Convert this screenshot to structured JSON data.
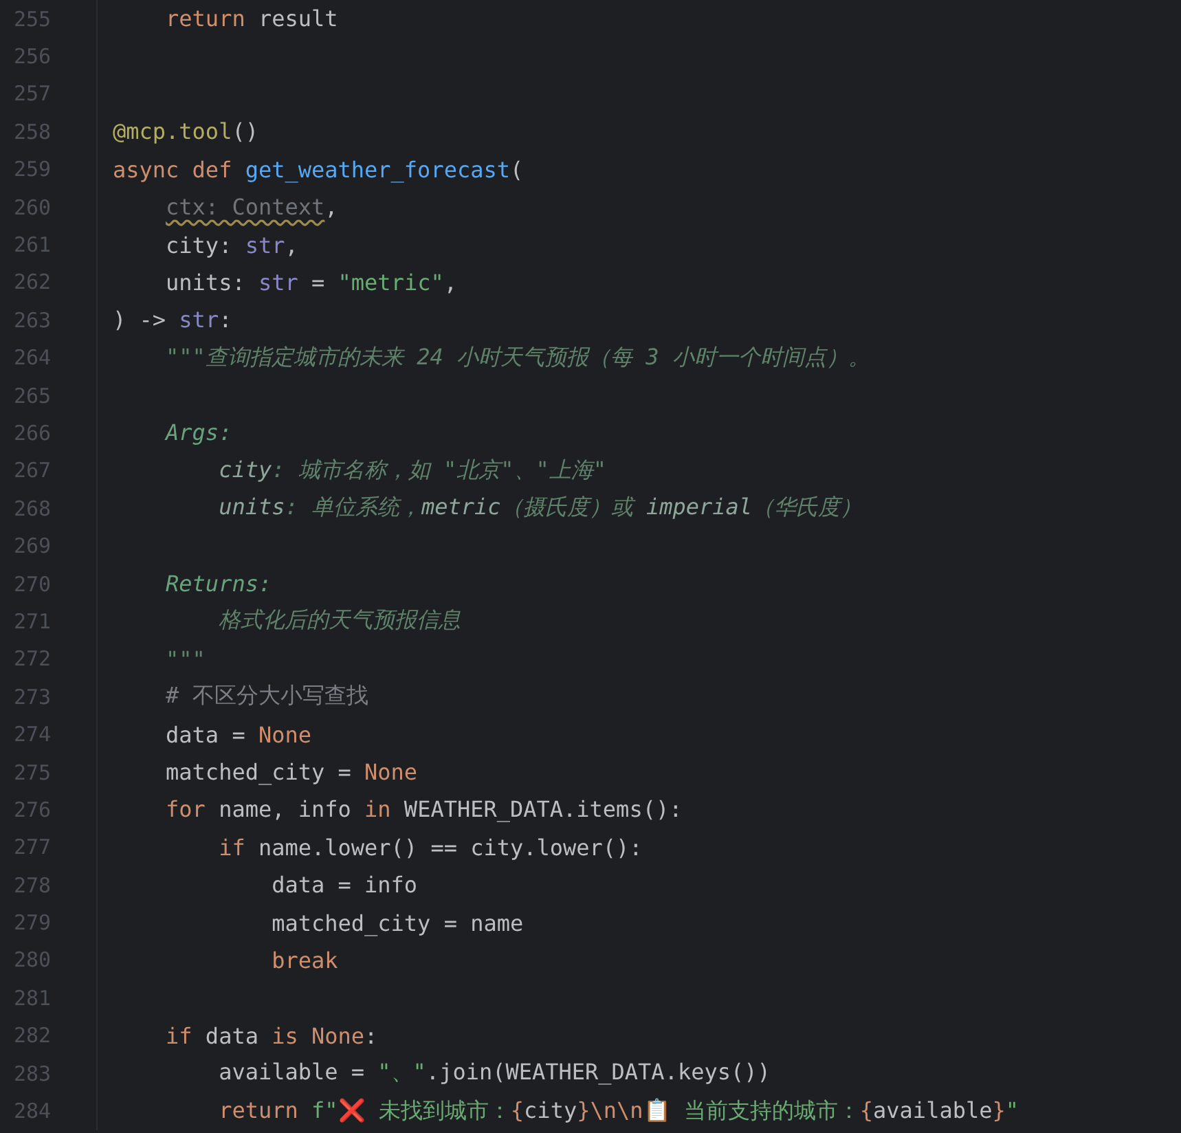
{
  "editor": {
    "lines": [
      {
        "children": [
          {
            "number": "255",
            "tokens": [
              {
                "kind": "keyword",
                "text": "return"
              },
              {
                "kind": "plain",
                "text": " result"
              }
            ]
          }
        ]
      },
      {
        "number": "256"
      },
      {
        "number": "257"
      },
      {
        "number": "258",
        "tokens": [
          {
            "kind": "decorator",
            "text": "@mcp.tool"
          },
          {
            "kind": "plain",
            "text": "()"
          }
        ]
      },
      {
        "number": "259",
        "tokens": [
          {
            "kind": "keyword",
            "text": "async def "
          },
          {
            "kind": "function",
            "text": "get_weather_forecast"
          },
          {
            "kind": "plain",
            "text": "("
          }
        ],
        "children": [
          {
            "number": "260",
            "tokens": [
              {
                "kind": "unused",
                "text": "ctx: Context"
              },
              {
                "kind": "plain",
                "text": ","
              }
            ]
          },
          {
            "number": "261",
            "tokens": [
              {
                "kind": "plain",
                "text": "city: "
              },
              {
                "kind": "type",
                "text": "str"
              },
              {
                "kind": "plain",
                "text": ","
              }
            ]
          },
          {
            "number": "262",
            "tokens": [
              {
                "kind": "plain",
                "text": "units: "
              },
              {
                "kind": "type",
                "text": "str"
              },
              {
                "kind": "plain",
                "text": " = "
              },
              {
                "kind": "string",
                "text": "\"metric\""
              },
              {
                "kind": "plain",
                "text": ","
              }
            ]
          }
        ]
      },
      {
        "number": "263",
        "tokens": [
          {
            "kind": "plain",
            "text": ") -> "
          },
          {
            "kind": "type",
            "text": "str"
          },
          {
            "kind": "plain",
            "text": ":"
          }
        ],
        "children": [
          {
            "number": "264",
            "tokens": [
              {
                "kind": "docstring",
                "text": "\"\"\"查询指定城市的未来 24 小时天气预报（每 3 小时一个时间点）。"
              }
            ]
          },
          {
            "number": "265"
          },
          {
            "number": "266",
            "tokens": [
              {
                "kind": "doctag",
                "text": "Args:"
              }
            ],
            "children": [
              {
                "number": "267",
                "tokens": [
                  {
                    "kind": "docparam",
                    "text": "city"
                  },
                  {
                    "kind": "docstring",
                    "text": ": 城市名称，如 \"北京\"、\"上海\""
                  }
                ]
              },
              {
                "number": "268",
                "tokens": [
                  {
                    "kind": "docparam",
                    "text": "units"
                  },
                  {
                    "kind": "docstring",
                    "text": ": 单位系统，"
                  },
                  {
                    "kind": "docparam",
                    "text": "metric"
                  },
                  {
                    "kind": "docstring",
                    "text": "（摄氏度）或 "
                  },
                  {
                    "kind": "docparam",
                    "text": "imperial"
                  },
                  {
                    "kind": "docstring",
                    "text": "（华氏度）"
                  }
                ]
              }
            ]
          },
          {
            "number": "269"
          },
          {
            "number": "270",
            "tokens": [
              {
                "kind": "doctag",
                "text": "Returns:"
              }
            ],
            "children": [
              {
                "number": "271",
                "tokens": [
                  {
                    "kind": "docstring",
                    "text": "格式化后的天气预报信息"
                  }
                ]
              }
            ]
          },
          {
            "number": "272",
            "tokens": [
              {
                "kind": "docstring",
                "text": "\"\"\""
              }
            ]
          },
          {
            "number": "273",
            "tokens": [
              {
                "kind": "comment",
                "text": "# 不区分大小写查找"
              }
            ]
          },
          {
            "number": "274",
            "tokens": [
              {
                "kind": "plain",
                "text": "data = "
              },
              {
                "kind": "keyword",
                "text": "None"
              }
            ]
          },
          {
            "number": "275",
            "tokens": [
              {
                "kind": "plain",
                "text": "matched_city = "
              },
              {
                "kind": "keyword",
                "text": "None"
              }
            ]
          },
          {
            "number": "276",
            "tokens": [
              {
                "kind": "keyword",
                "text": "for"
              },
              {
                "kind": "plain",
                "text": " name, info "
              },
              {
                "kind": "keyword",
                "text": "in"
              },
              {
                "kind": "plain",
                "text": " WEATHER_DATA.items():"
              }
            ],
            "children": [
              {
                "number": "277",
                "tokens": [
                  {
                    "kind": "keyword",
                    "text": "if"
                  },
                  {
                    "kind": "plain",
                    "text": " name.lower() == city.lower():"
                  }
                ],
                "children": [
                  {
                    "number": "278",
                    "tokens": [
                      {
                        "kind": "plain",
                        "text": "data = info"
                      }
                    ]
                  },
                  {
                    "number": "279",
                    "tokens": [
                      {
                        "kind": "plain",
                        "text": "matched_city = name"
                      }
                    ]
                  },
                  {
                    "number": "280",
                    "tokens": [
                      {
                        "kind": "keyword",
                        "text": "break"
                      }
                    ]
                  }
                ]
              }
            ]
          },
          {
            "number": "281"
          },
          {
            "number": "282",
            "tokens": [
              {
                "kind": "keyword",
                "text": "if"
              },
              {
                "kind": "plain",
                "text": " data "
              },
              {
                "kind": "keyword",
                "text": "is None"
              },
              {
                "kind": "plain",
                "text": ":"
              }
            ],
            "children": [
              {
                "number": "283",
                "tokens": [
                  {
                    "kind": "plain",
                    "text": "available = "
                  },
                  {
                    "kind": "string",
                    "text": "\"、\""
                  },
                  {
                    "kind": "plain",
                    "text": ".join(WEATHER_DATA.keys())"
                  }
                ]
              },
              {
                "number": "284",
                "tokens": [
                  {
                    "kind": "keyword",
                    "text": "return "
                  },
                  {
                    "kind": "string",
                    "text": "f\"❌ 未找到城市："
                  },
                  {
                    "kind": "escape",
                    "text": "{"
                  },
                  {
                    "kind": "plain",
                    "text": "city"
                  },
                  {
                    "kind": "escape",
                    "text": "}\\n\\n"
                  },
                  {
                    "kind": "string",
                    "text": "📋 当前支持的城市："
                  },
                  {
                    "kind": "escape",
                    "text": "{"
                  },
                  {
                    "kind": "plain",
                    "text": "available"
                  },
                  {
                    "kind": "escape",
                    "text": "}"
                  },
                  {
                    "kind": "string",
                    "text": "\""
                  }
                ]
              }
            ]
          }
        ]
      }
    ]
  }
}
